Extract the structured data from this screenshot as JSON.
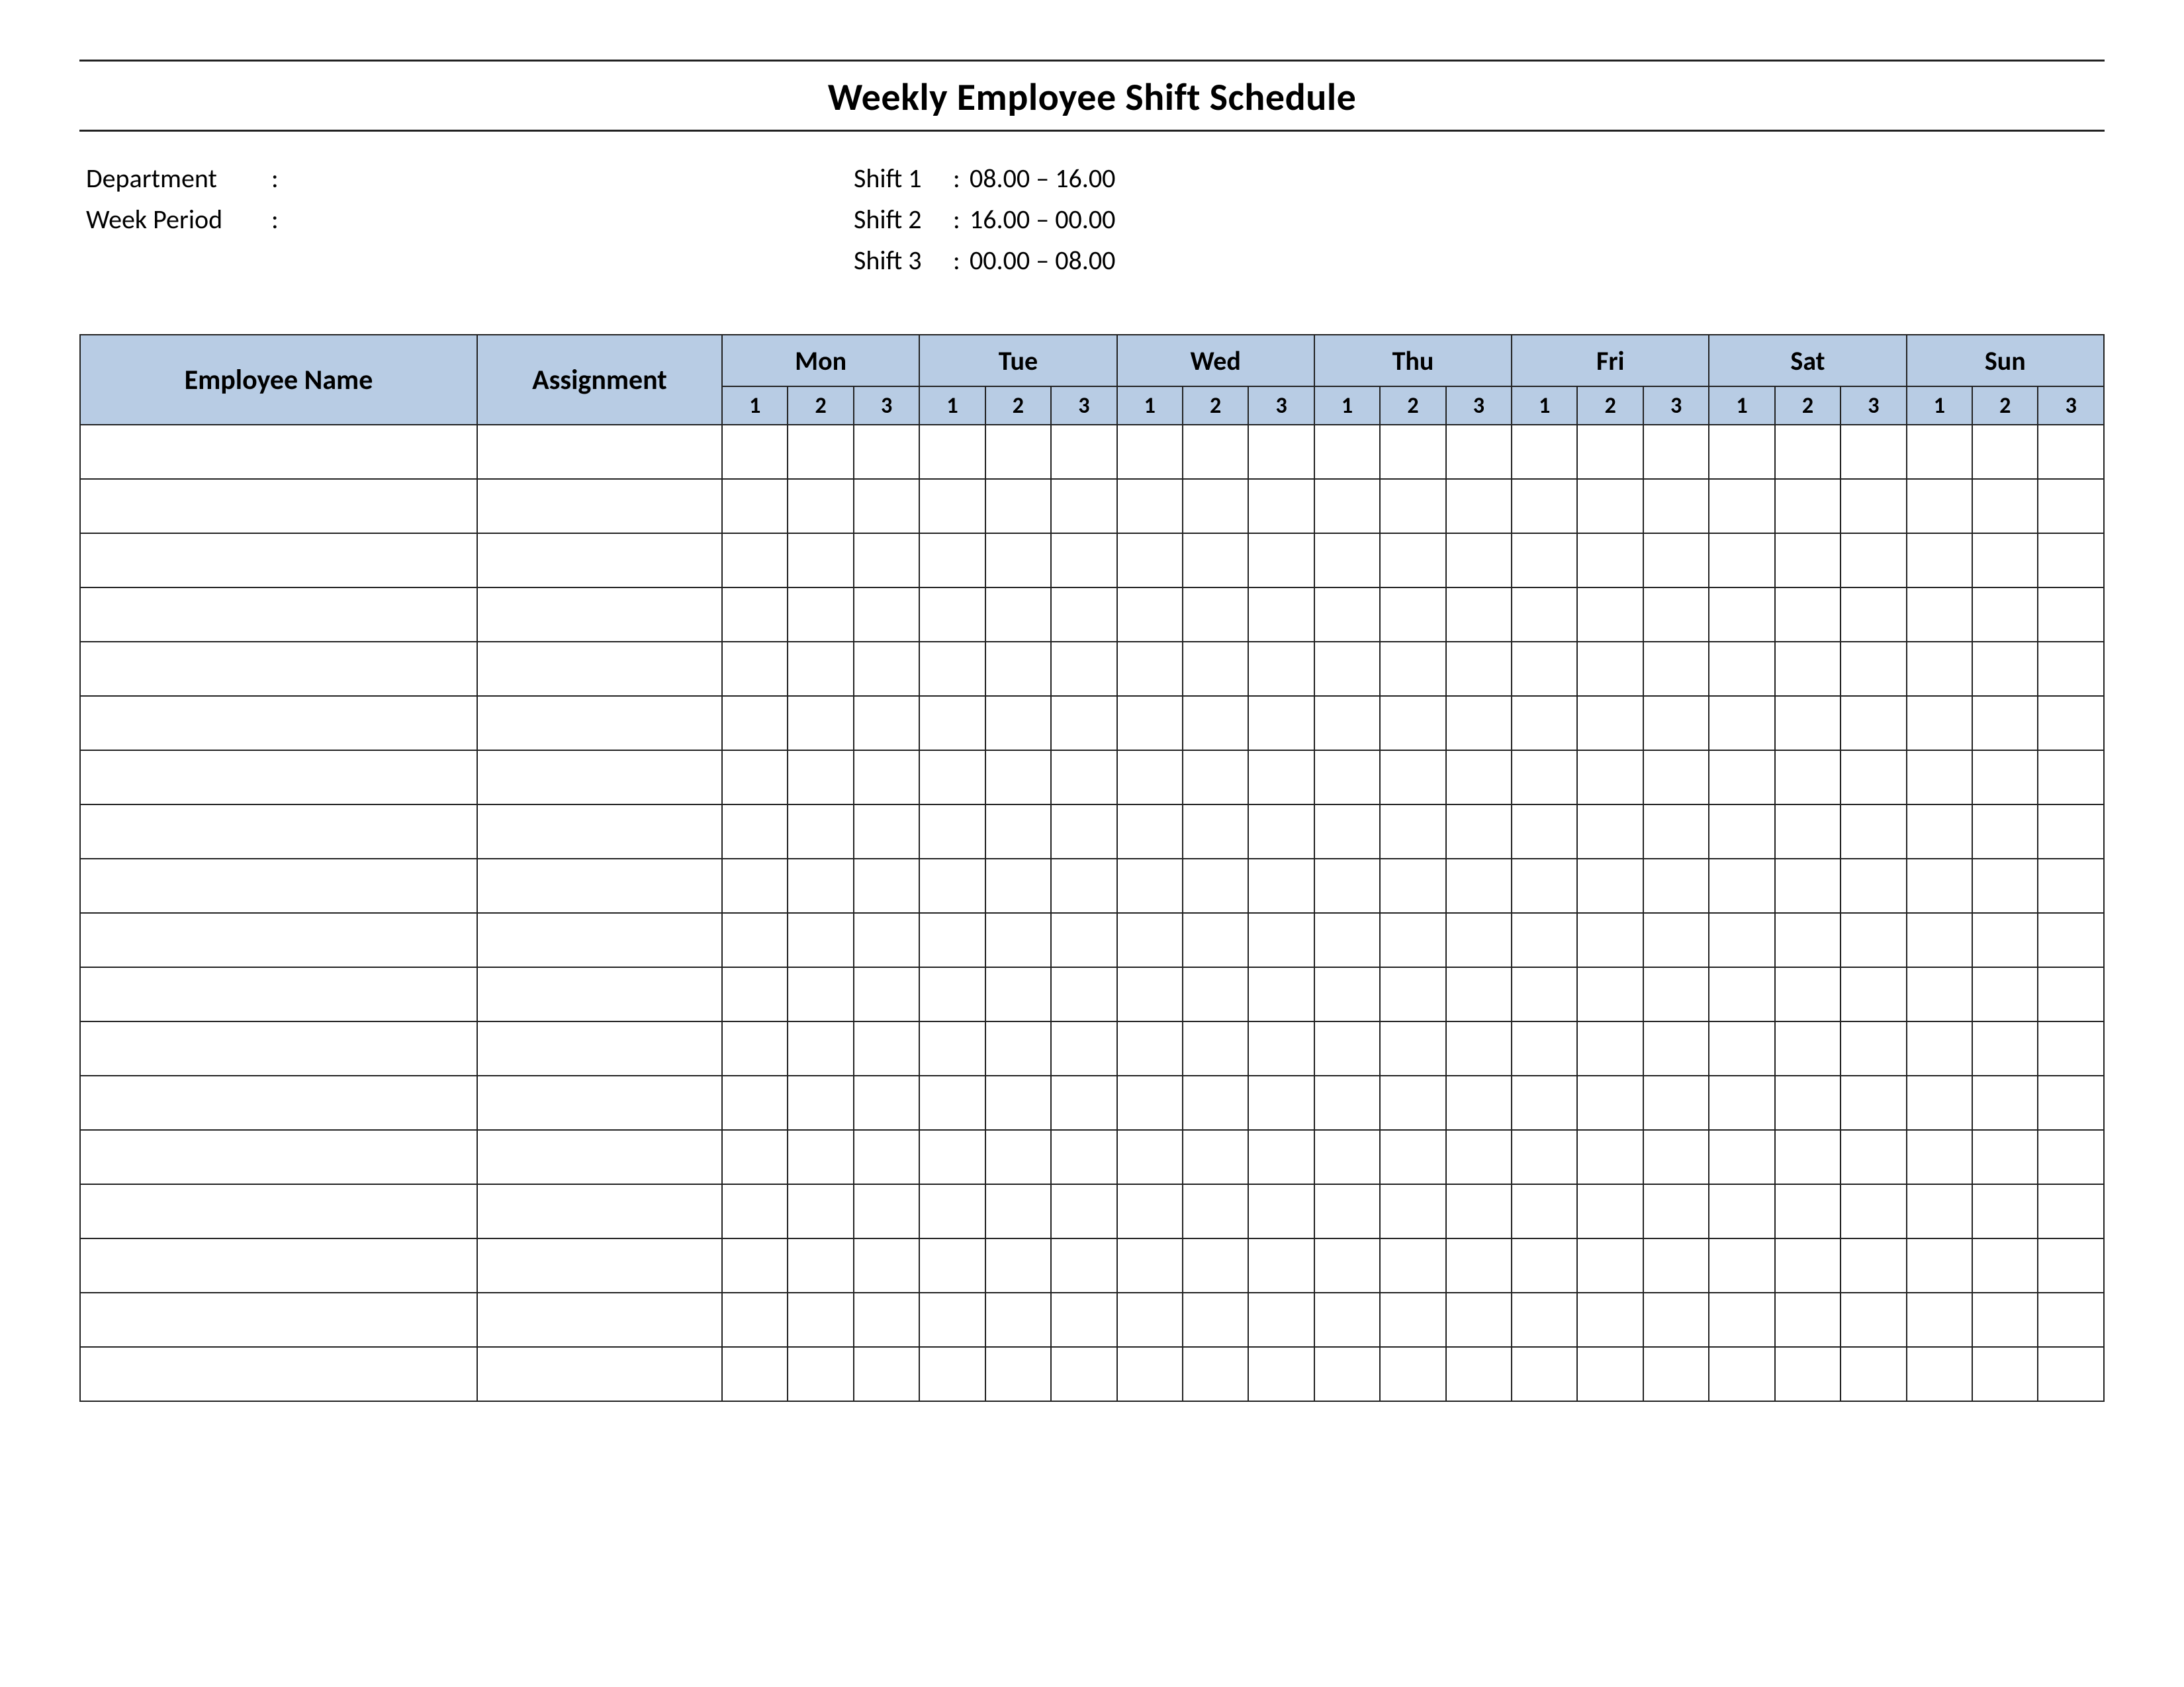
{
  "title": "Weekly Employee Shift Schedule",
  "info": {
    "department_label": "Department",
    "department_value": "",
    "week_period_label": "Week  Period",
    "week_period_value": "",
    "shifts": [
      {
        "label": "Shift 1",
        "time": "08.00  – 16.00"
      },
      {
        "label": "Shift 2",
        "time": "16.00  – 00.00"
      },
      {
        "label": "Shift 3",
        "time": "00.00  – 08.00"
      }
    ]
  },
  "table": {
    "employee_header": "Employee Name",
    "assignment_header": "Assignment",
    "days": [
      "Mon",
      "Tue",
      "Wed",
      "Thu",
      "Fri",
      "Sat",
      "Sun"
    ],
    "shift_numbers": [
      "1",
      "2",
      "3"
    ],
    "row_count": 18
  },
  "colon": ":"
}
